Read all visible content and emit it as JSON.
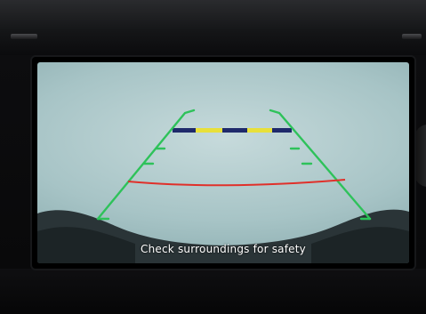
{
  "camera_view": {
    "message": "Check surroundings for safety",
    "guide_colors": {
      "side_lines": "#2ec25a",
      "distance_line": "#e0302a",
      "hitch_bar_dark": "#1f2a6b",
      "hitch_bar_light": "#e8e03a"
    }
  }
}
